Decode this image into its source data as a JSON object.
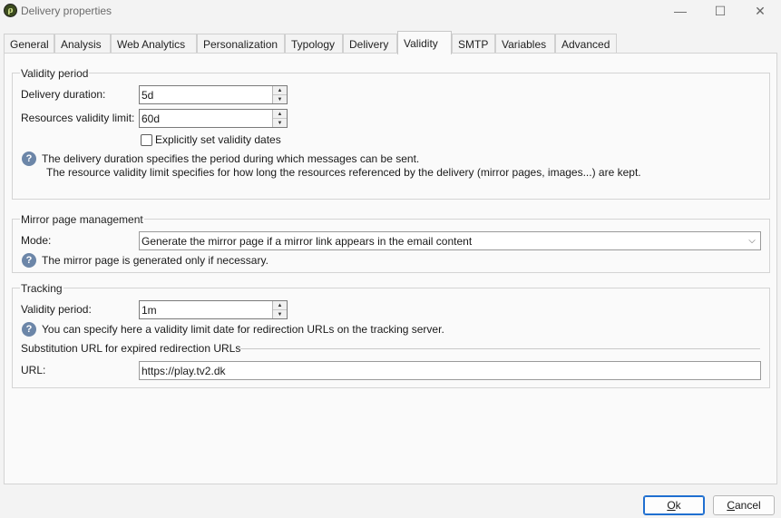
{
  "window": {
    "title": "Delivery properties",
    "icon": "app-logo-icon",
    "controls": {
      "minimize": "—",
      "maximize": "☐",
      "close": "✕"
    }
  },
  "tabs": [
    {
      "label": "General"
    },
    {
      "label": "Analysis"
    },
    {
      "label": "Web Analytics"
    },
    {
      "label": "Personalization"
    },
    {
      "label": "Typology"
    },
    {
      "label": "Delivery"
    },
    {
      "label": "Validity",
      "active": true
    },
    {
      "label": "SMTP"
    },
    {
      "label": "Variables"
    },
    {
      "label": "Advanced"
    }
  ],
  "validity_period": {
    "title": "Validity period",
    "delivery_duration": {
      "label": "Delivery duration:",
      "value": "5d"
    },
    "resources_validity": {
      "label": "Resources validity limit:",
      "value": "60d"
    },
    "explicit_dates": {
      "label": "Explicitly set validity dates",
      "checked": false
    },
    "help_line1": "The delivery duration specifies the period during which messages can be sent.",
    "help_line2": "The resource validity limit specifies for how long the resources referenced by the delivery (mirror pages, images...) are kept."
  },
  "mirror_page": {
    "title": "Mirror page management",
    "mode_label": "Mode:",
    "mode_value": "Generate the mirror page if a mirror link appears in the email content",
    "help": "The mirror page is generated only if necessary."
  },
  "tracking": {
    "title": "Tracking",
    "validity_label": "Validity period:",
    "validity_value": "1m",
    "help": "You can specify here a validity limit date for redirection URLs on the tracking server.",
    "substitution_title": "Substitution URL for expired redirection URLs",
    "url_label": "URL:",
    "url_value": "https://play.tv2.dk"
  },
  "buttons": {
    "ok": "Ok",
    "cancel": "Cancel"
  },
  "colors": {
    "help_icon": "#6c86a8",
    "ok_border": "#1f6fd0"
  }
}
